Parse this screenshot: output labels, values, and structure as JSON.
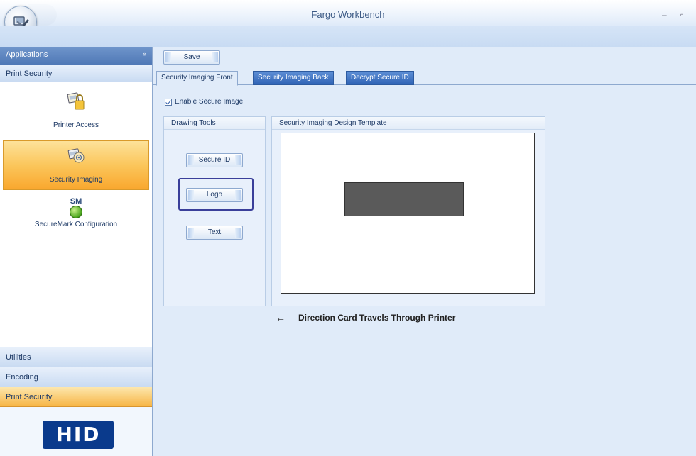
{
  "window": {
    "title": "Fargo Workbench",
    "minimize_glyph": "–",
    "maximize_glyph": "▫"
  },
  "nav": {
    "header_label": "Applications",
    "chevron_glyph": "«",
    "group_label": "Print Security",
    "items": [
      {
        "label": "Printer Access",
        "icon": "printer-lock-icon",
        "active": false
      },
      {
        "label": "Security Imaging",
        "icon": "security-imaging-icon",
        "active": true
      },
      {
        "label": "SecureMark Configuration",
        "icon": "securemark-icon",
        "badge": "SM",
        "active": false
      }
    ],
    "bottom_groups": [
      {
        "label": "Utilities"
      },
      {
        "label": "Encoding"
      },
      {
        "label": "Print Security",
        "active": true
      }
    ],
    "logo_text": "HID"
  },
  "toolbar": {
    "save_label": "Save"
  },
  "tabs": [
    {
      "label": "Security Imaging Front",
      "active": true
    },
    {
      "label": "Security Imaging Back",
      "active": false
    },
    {
      "label": "Decrypt Secure ID",
      "active": false
    }
  ],
  "enable_secure_image": {
    "label": "Enable Secure Image",
    "checked": true
  },
  "drawing_tools": {
    "title": "Drawing Tools",
    "buttons": [
      "Secure ID",
      "Logo",
      "Text"
    ],
    "selected": "Logo"
  },
  "design_template": {
    "title": "Security Imaging Design Template"
  },
  "direction_note": {
    "arrow": "←",
    "text": "Direction Card Travels Through Printer"
  },
  "colors": {
    "accent_orange": "#f9a72e",
    "tab_blue": "#2f63b5",
    "nav_header": "#4e77b5",
    "hid_blue": "#0a3a8c",
    "logo_placeholder": "#5a5a5a"
  }
}
